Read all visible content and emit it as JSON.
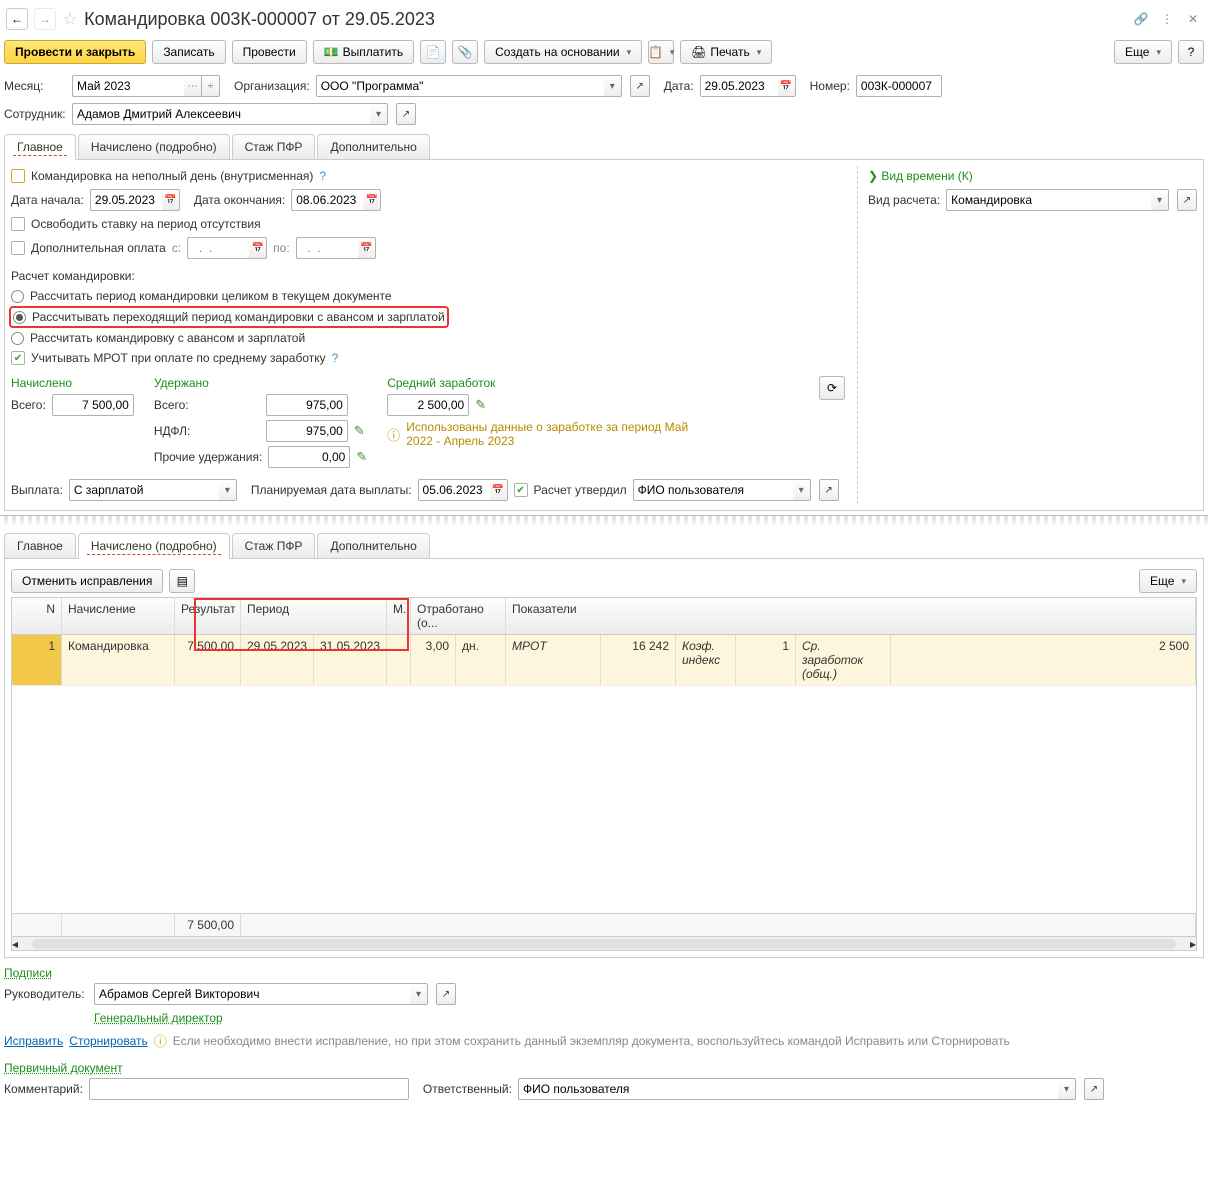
{
  "header": {
    "title": "Командировка 003К-000007 от 29.05.2023"
  },
  "toolbar": {
    "post_close": "Провести и закрыть",
    "save": "Записать",
    "post": "Провести",
    "pay": "Выплатить",
    "create_based": "Создать на основании",
    "print": "Печать",
    "more": "Еще",
    "help": "?"
  },
  "fields": {
    "month_lbl": "Месяц:",
    "month": "Май 2023",
    "org_lbl": "Организация:",
    "org": "ООО \"Программа\"",
    "date_lbl": "Дата:",
    "date": "29.05.2023",
    "num_lbl": "Номер:",
    "num": "003К-000007",
    "emp_lbl": "Сотрудник:",
    "emp": "Адамов Дмитрий Алексеевич"
  },
  "tabs1": {
    "t1": "Главное",
    "t2": "Начислено (подробно)",
    "t3": "Стаж ПФР",
    "t4": "Дополнительно"
  },
  "main": {
    "cb_partial": "Командировка на неполный день (внутрисменная)",
    "help_q": "?",
    "start_lbl": "Дата начала:",
    "start": "29.05.2023",
    "end_lbl": "Дата окончания:",
    "end": "08.06.2023",
    "cb_free": "Освободить ставку на период отсутствия",
    "cb_extra": "Дополнительная оплата",
    "extra_from": "с:",
    "extra_ph": "  .  .    ",
    "extra_to": "по:",
    "calc_lbl": "Расчет командировки:",
    "r1": "Рассчитать период командировки целиком в текущем документе",
    "r2": "Рассчитывать переходящий период командировки с авансом и зарплатой",
    "r3": "Рассчитать командировку с авансом и зарплатой",
    "cb_mrot": "Учитывать МРОТ при оплате по среднему заработку",
    "time_kind": "Вид времени (К)",
    "calc_type_lbl": "Вид расчета:",
    "calc_type": "Командировка"
  },
  "totals": {
    "accrued_lbl": "Начислено",
    "withheld_lbl": "Удержано",
    "avg_lbl": "Средний заработок",
    "total_lbl": "Всего:",
    "accrued_total": "7 500,00",
    "withheld_total": "975,00",
    "ndfl_lbl": "НДФЛ:",
    "ndfl": "975,00",
    "other_lbl": "Прочие удержания:",
    "other": "0,00",
    "avg": "2 500,00",
    "note": "Использованы данные о заработке за период Май 2022 - Апрель 2023"
  },
  "pay": {
    "pay_lbl": "Выплата:",
    "pay_val": "С зарплатой",
    "plan_lbl": "Планируемая дата выплаты:",
    "plan_date": "05.06.2023",
    "approve_lbl": "Расчет утвердил",
    "approver": "ФИО пользователя"
  },
  "grid_tb": {
    "cancel": "Отменить исправления",
    "more": "Еще"
  },
  "grid": {
    "h": {
      "n": "N",
      "acc": "Начисление",
      "res": "Результат",
      "per": "Период",
      "m": "М.",
      "wrk": "Отработано (о...",
      "ind": "Показатели"
    },
    "row": {
      "n": "1",
      "acc": "Командировка",
      "res": "7 500,00",
      "p1": "29.05.2023",
      "p2": "31.05.2023",
      "wrk": "3,00",
      "unit": "дн.",
      "i1": "МРОТ",
      "v1": "16 242",
      "i2": "Коэф. индекс",
      "v2": "1",
      "i3": "Ср. заработок (общ.)",
      "v3": "2 500"
    },
    "footer_res": "7 500,00"
  },
  "sign": {
    "title": "Подписи",
    "mgr_lbl": "Руководитель:",
    "mgr": "Абрамов Сергей Викторович",
    "pos": "Генеральный директор"
  },
  "actions": {
    "fix": "Исправить",
    "storno": "Сторнировать",
    "note": "Если необходимо внести исправление, но при этом сохранить данный экземпляр документа, воспользуйтесь командой Исправить или Сторнировать"
  },
  "primary_doc": "Первичный документ",
  "footer": {
    "comment_lbl": "Комментарий:",
    "resp_lbl": "Ответственный:",
    "resp": "ФИО пользователя"
  }
}
